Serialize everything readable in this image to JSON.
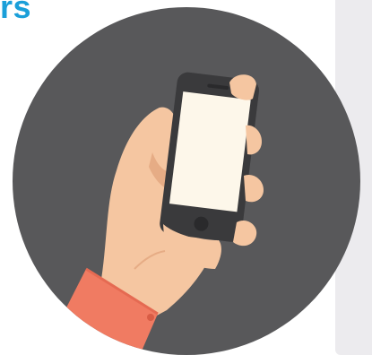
{
  "heading": {
    "text": "rs"
  },
  "illustration": {
    "icon": "hand-holding-smartphone-icon"
  },
  "colors": {
    "heading": "#1a9fd9",
    "circle": "#58585a",
    "side_panel": "#ecebee",
    "skin": "#f5c6a1",
    "skin_shadow": "#e6ac85",
    "sleeve": "#f07b62",
    "phone_body": "#3a3a3c",
    "phone_screen": "#fdf7ea"
  }
}
